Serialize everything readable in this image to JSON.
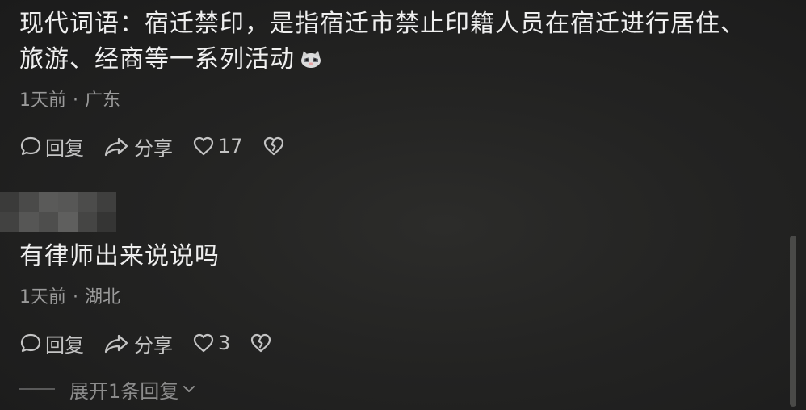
{
  "comments": [
    {
      "text": "现代词语：宿迁禁印，是指宿迁市禁止印籍人员在宿迁进行居住、旅游、经商等一系列活动",
      "emoji": "cat-face-emoji",
      "time": "1天前",
      "separator": "·",
      "location": "广东",
      "reply_label": "回复",
      "share_label": "分享",
      "likes": "17"
    },
    {
      "text": "有律师出来说说吗",
      "time": "1天前",
      "separator": "·",
      "location": "湖北",
      "reply_label": "回复",
      "share_label": "分享",
      "likes": "3",
      "expand_label": "展开1条回复"
    }
  ],
  "icons": {
    "reply": "speech-bubble-icon",
    "share": "share-arrow-icon",
    "like": "heart-outline-icon",
    "dislike": "broken-heart-icon",
    "expand": "chevron-down-icon"
  },
  "colors": {
    "background": "#232322",
    "text": "#efefef",
    "meta": "#9a9a9a",
    "actions": "#c4c4c4"
  }
}
